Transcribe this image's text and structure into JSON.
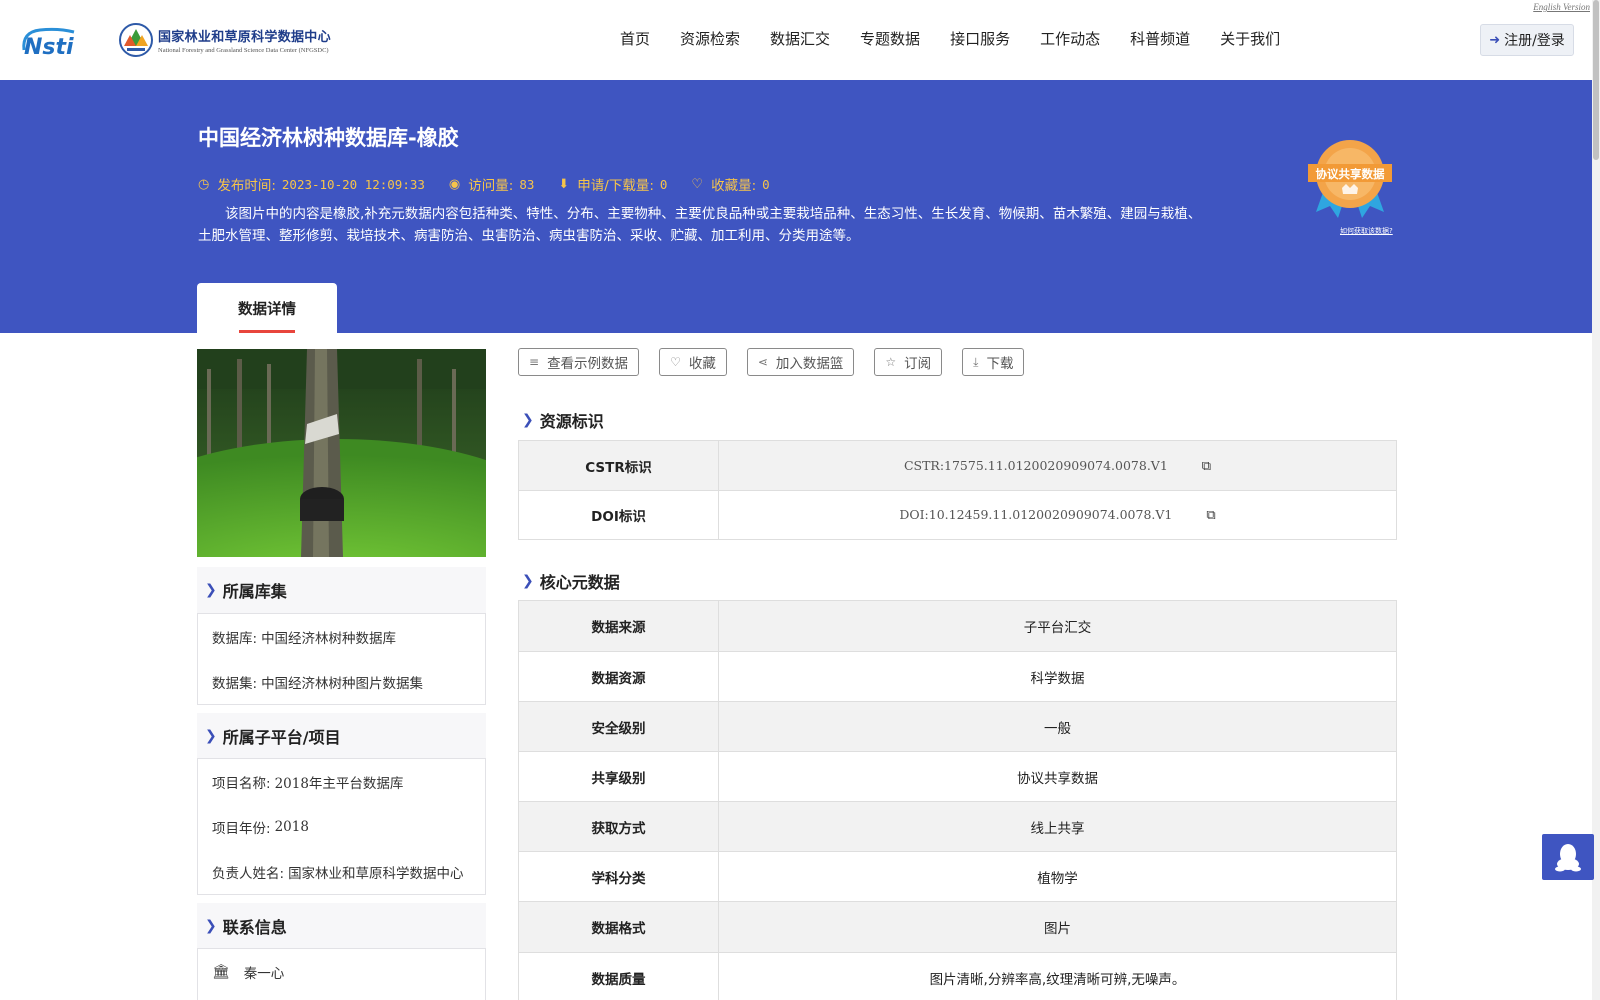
{
  "header": {
    "logo_cn": "国家林业和草原科学数据中心",
    "logo_en": "National Forestry and Grassland Science Data Center (NFGSDC)",
    "nav": [
      "首页",
      "资源检索",
      "数据汇交",
      "专题数据",
      "接口服务",
      "工作动态",
      "科普频道",
      "关于我们"
    ],
    "english_version": "English Version",
    "login_label": "注册/登录"
  },
  "banner": {
    "title": "中国经济林树种数据库-橡胶",
    "publish_label": "发布时间:",
    "publish_time": "2023-10-20 12:09:33",
    "views_label": "访问量:",
    "views": "83",
    "downloads_label": "申请/下载量:",
    "downloads": "0",
    "favorites_label": "收藏量:",
    "favorites": "0",
    "description": "该图片中的内容是橡胶,补充元数据内容包括种类、特性、分布、主要物种、主要优良品种或主要栽培品种、生态习性、生长发育、物候期、苗木繁殖、建园与栽植、土肥水管理、整形修剪、栽培技术、病害防治、虫害防治、病虫害防治、采收、贮藏、加工利用、分类用途等。",
    "badge_text": "协议共享数据",
    "badge_link": "如何获取该数据?",
    "tab_label": "数据详情"
  },
  "sidebar": {
    "library_title": "所属库集",
    "library_rows": [
      {
        "k": "数据库:",
        "v": "中国经济林树种数据库"
      },
      {
        "k": "数据集:",
        "v": "中国经济林树种图片数据集"
      }
    ],
    "project_title": "所属子平台/项目",
    "project_rows": [
      {
        "k": "项目名称:",
        "v": "2018年主平台数据库"
      },
      {
        "k": "项目年份:",
        "v": "2018"
      },
      {
        "k": "负责人姓名:",
        "v": "国家林业和草原科学数据中心"
      }
    ],
    "contact_title": "联系信息",
    "contact_name": "秦一心"
  },
  "actions": {
    "sample": "查看示例数据",
    "favorite": "收藏",
    "basket": "加入数据篮",
    "subscribe": "订阅",
    "download": "下载"
  },
  "identifiers": {
    "title": "资源标识",
    "rows": [
      {
        "k": "CSTR标识",
        "v": "CSTR:17575.11.0120020909074.0078.V1"
      },
      {
        "k": "DOI标识",
        "v": "DOI:10.12459.11.0120020909074.0078.V1"
      }
    ]
  },
  "core": {
    "title": "核心元数据",
    "rows": [
      {
        "k": "数据来源",
        "v": "子平台汇交"
      },
      {
        "k": "数据资源",
        "v": "科学数据"
      },
      {
        "k": "安全级别",
        "v": "一般"
      },
      {
        "k": "共享级别",
        "v": "协议共享数据"
      },
      {
        "k": "获取方式",
        "v": "线上共享"
      },
      {
        "k": "学科分类",
        "v": "植物学"
      },
      {
        "k": "数据格式",
        "v": "图片"
      },
      {
        "k": "数据质量",
        "v": "图片清晰,分辨率高,纹理清晰可辨,无噪声。"
      }
    ]
  },
  "colors": {
    "banner": "#3f55c1",
    "accent": "#f6c44a",
    "tab_underline": "#e8453c"
  }
}
